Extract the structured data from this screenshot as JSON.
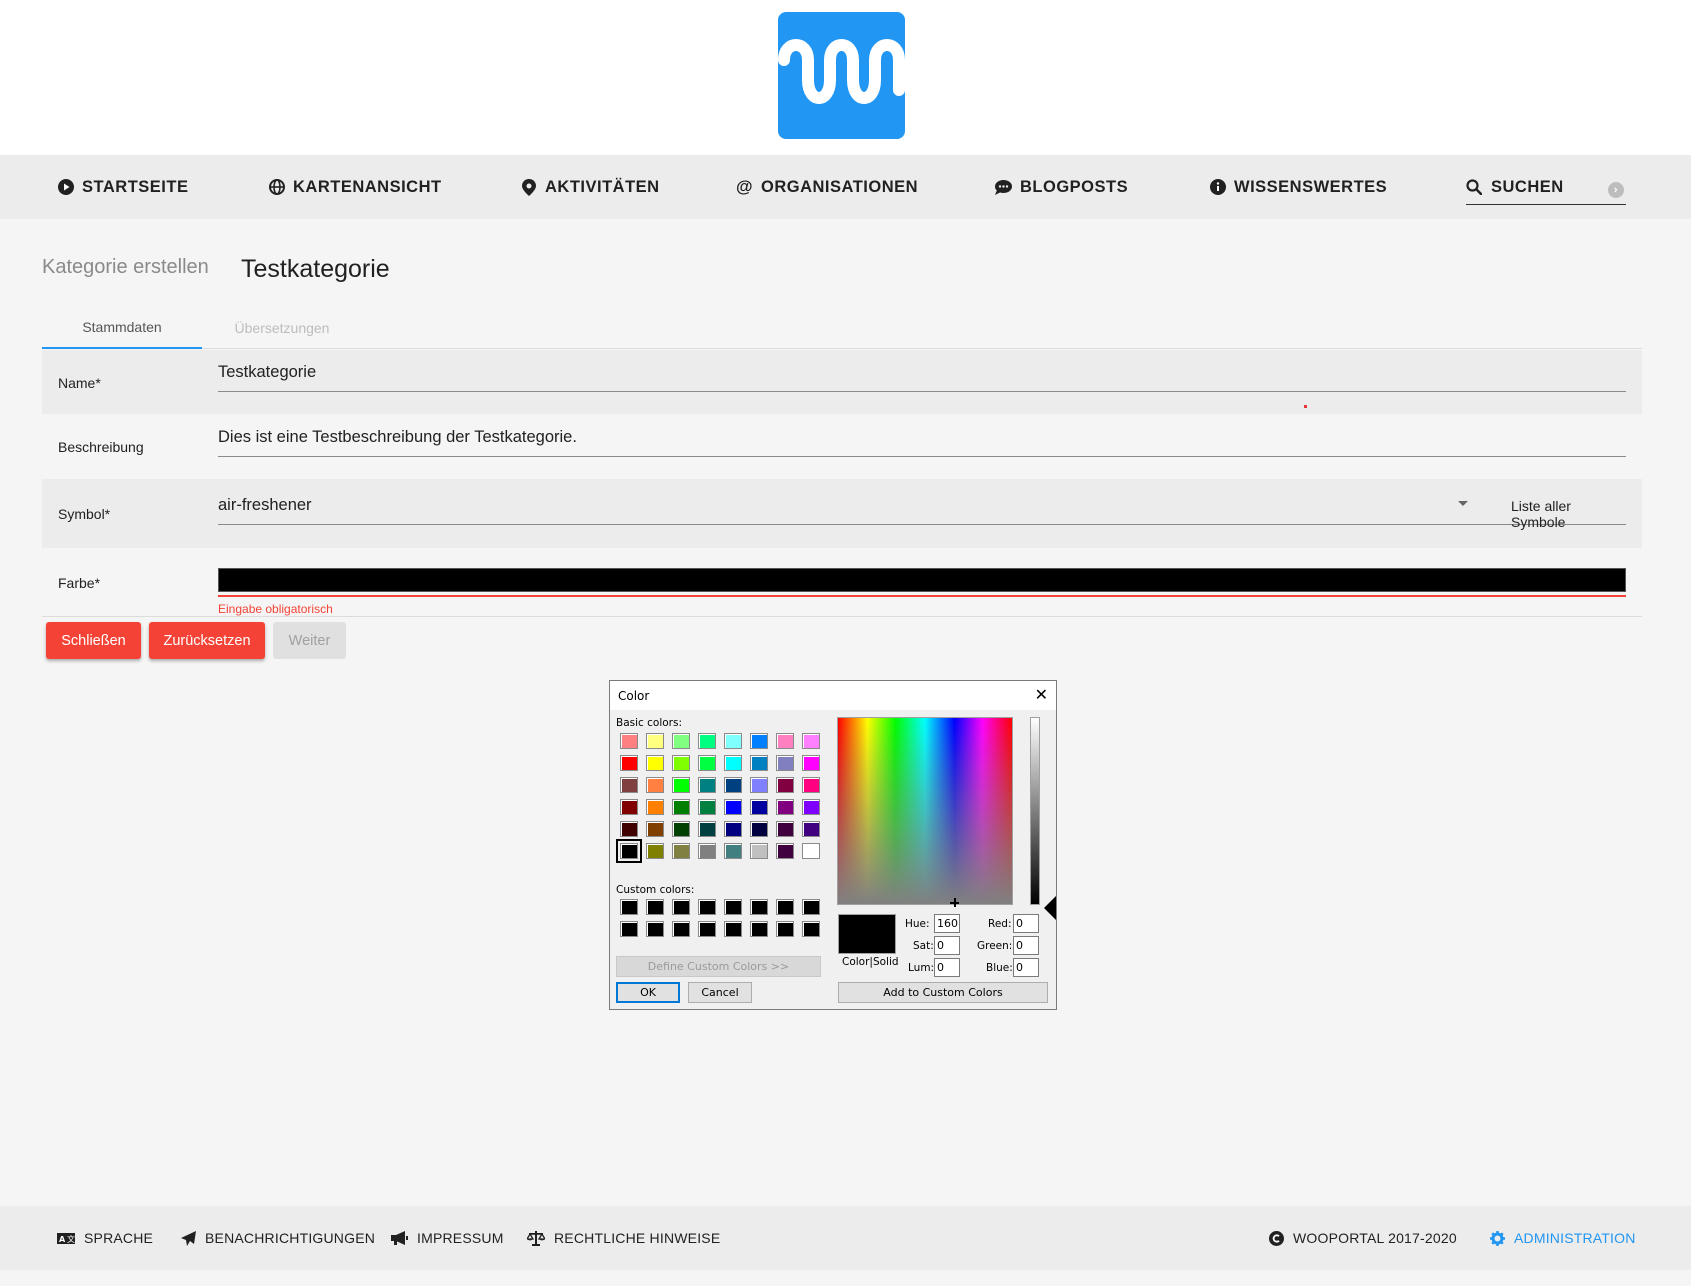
{
  "nav": {
    "items": [
      {
        "label": "STARTSEITE",
        "icon": "play-circle-icon"
      },
      {
        "label": "KARTENANSICHT",
        "icon": "globe-icon"
      },
      {
        "label": "AKTIVITÄTEN",
        "icon": "map-marker-icon"
      },
      {
        "label": "ORGANISATIONEN",
        "icon": "at-icon"
      },
      {
        "label": "BLOGPOSTS",
        "icon": "comment-icon"
      },
      {
        "label": "WISSENSWERTES",
        "icon": "info-icon"
      }
    ],
    "search_label": "SUCHEN"
  },
  "page": {
    "subtitle": "Kategorie erstellen",
    "title": "Testkategorie"
  },
  "tabs": [
    {
      "label": "Stammdaten"
    },
    {
      "label": "Übersetzungen"
    }
  ],
  "form": {
    "name": {
      "label": "Name*",
      "value": "Testkategorie"
    },
    "description": {
      "label": "Beschreibung",
      "value": "Dies ist eine Testbeschreibung der Testkategorie."
    },
    "symbol": {
      "label": "Symbol*",
      "value": "air-freshener",
      "list_link": "Liste aller Symbole"
    },
    "color": {
      "label": "Farbe*",
      "value_color": "#000000",
      "error": "Eingabe obligatorisch"
    }
  },
  "buttons": {
    "close": "Schließen",
    "reset": "Zurücksetzen",
    "next": "Weiter"
  },
  "dialog": {
    "title": "Color",
    "basic_colors_label": "Basic colors:",
    "custom_colors_label": "Custom colors:",
    "define_custom": "Define Custom Colors >>",
    "ok": "OK",
    "cancel": "Cancel",
    "color_solid": "Color|Solid",
    "hue_label": "Hue:",
    "sat_label": "Sat:",
    "lum_label": "Lum:",
    "red_label": "Red:",
    "green_label": "Green:",
    "blue_label": "Blue:",
    "hue": "160",
    "sat": "0",
    "lum": "0",
    "red": "0",
    "green": "0",
    "blue": "0",
    "add_custom": "Add to Custom Colors",
    "basic_colors": [
      "#ff8080",
      "#ffff80",
      "#80ff80",
      "#00ff80",
      "#80ffff",
      "#0080ff",
      "#ff80c0",
      "#ff80ff",
      "#ff0000",
      "#ffff00",
      "#80ff00",
      "#00ff40",
      "#00ffff",
      "#0080c0",
      "#8080c0",
      "#ff00ff",
      "#804040",
      "#ff8040",
      "#00ff00",
      "#008080",
      "#004080",
      "#8080ff",
      "#800040",
      "#ff0080",
      "#800000",
      "#ff8000",
      "#008000",
      "#008040",
      "#0000ff",
      "#0000a0",
      "#800080",
      "#8000ff",
      "#400000",
      "#804000",
      "#004000",
      "#004040",
      "#000080",
      "#000040",
      "#400040",
      "#400080",
      "#000000",
      "#808000",
      "#808040",
      "#808080",
      "#408080",
      "#c0c0c0",
      "#400040",
      "#ffffff"
    ],
    "custom_colors": [
      "#000000",
      "#000000",
      "#000000",
      "#000000",
      "#000000",
      "#000000",
      "#000000",
      "#000000",
      "#000000",
      "#000000",
      "#000000",
      "#000000",
      "#000000",
      "#000000",
      "#000000",
      "#000000"
    ]
  },
  "footer": {
    "language": "SPRACHE",
    "notifications": "BENACHRICHTIGUNGEN",
    "imprint": "IMPRESSUM",
    "legal": "RECHTLICHE HINWEISE",
    "copyright": "WOOPORTAL 2017-2020",
    "admin": "ADMINISTRATION"
  },
  "colors": {
    "accent": "#2196f3",
    "danger": "#f44336"
  }
}
